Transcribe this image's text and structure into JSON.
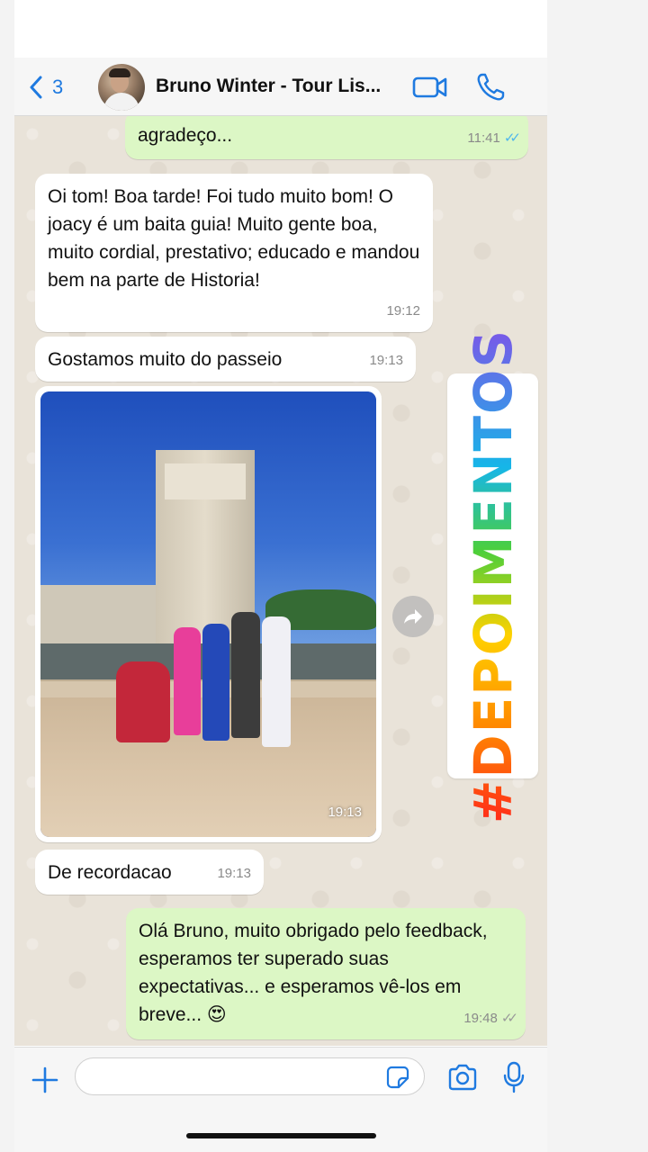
{
  "header": {
    "back_count": "3",
    "contact_name": "Bruno Winter - Tour Lis..."
  },
  "messages": [
    {
      "direction": "out",
      "text": "agradeço...",
      "time": "11:41",
      "status": "read"
    },
    {
      "direction": "in",
      "text": "Oi tom! Boa tarde! Foi tudo muito bom! O joacy é um baita guia! Muito gente boa, muito cordial, prestativo; educado e mandou bem na parte de Historia!",
      "time": "19:12"
    },
    {
      "direction": "in",
      "text": "Gostamos muito do passeio",
      "time": "19:13"
    },
    {
      "direction": "in",
      "type": "photo",
      "time": "19:13"
    },
    {
      "direction": "in",
      "text": "De recordacao",
      "time": "19:13"
    },
    {
      "direction": "out",
      "text": "Olá Bruno, muito obrigado pelo feedback, esperamos ter superado suas expectativas... e esperamos vê-los em breve... 😍",
      "time": "19:48",
      "status": "delivered"
    }
  ],
  "sticker": {
    "text": "#DEPOIMENTOS"
  },
  "input": {
    "placeholder": ""
  },
  "colors": {
    "accent": "#1f7ae0",
    "outgoing_bubble": "#dcf7c5",
    "incoming_bubble": "#ffffff",
    "read_ticks": "#4fb6ec"
  }
}
